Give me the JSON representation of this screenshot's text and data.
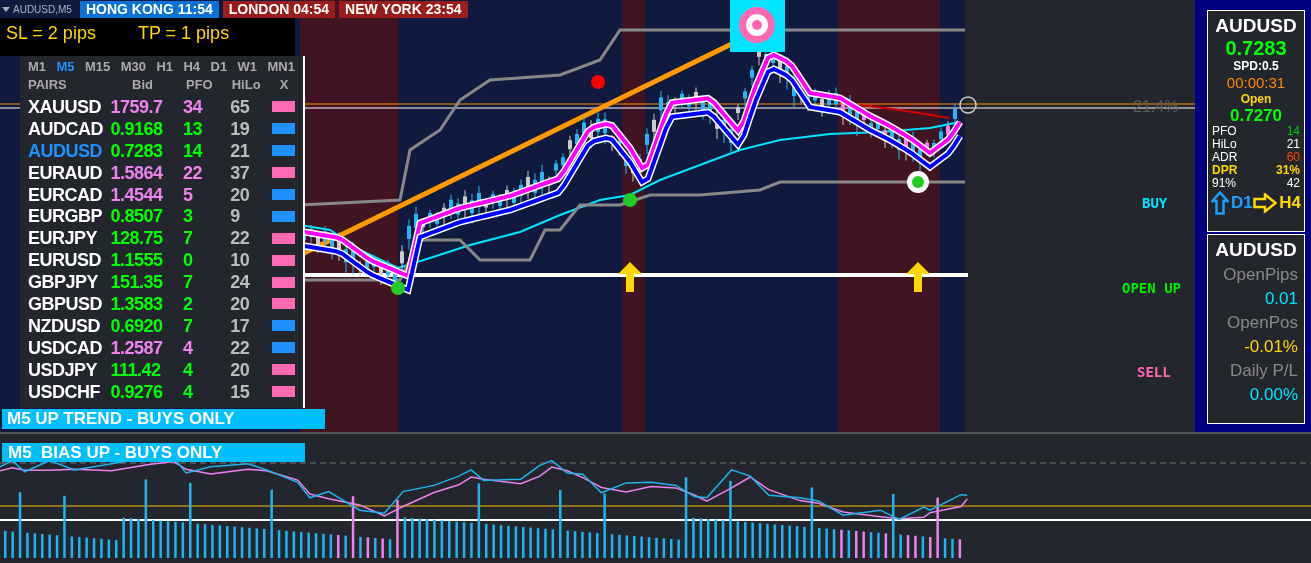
{
  "symbol_label": "AUDUSD,M5",
  "sessions": [
    {
      "city": "HONG KONG",
      "time": "11:54",
      "active": true
    },
    {
      "city": "LONDON",
      "time": "04:54",
      "active": false
    },
    {
      "city": "NEW YORK",
      "time": "23:54",
      "active": false
    }
  ],
  "trade_settings": [
    "SL = 2 pips",
    "TP = 1 pips"
  ],
  "dashboard": {
    "timeframes": [
      {
        "label": "M1",
        "selected": false
      },
      {
        "label": "M5",
        "selected": true
      },
      {
        "label": "M15",
        "selected": false
      },
      {
        "label": "M30",
        "selected": false
      },
      {
        "label": "H1",
        "selected": false
      },
      {
        "label": "H4",
        "selected": false
      },
      {
        "label": "D1",
        "selected": false
      },
      {
        "label": "W1",
        "selected": false
      },
      {
        "label": "MN1",
        "selected": false
      }
    ],
    "columns": [
      "PAIRS",
      "Bid",
      "PFO",
      "HiLo",
      "X"
    ],
    "rows": [
      {
        "pair": "XAUUSD",
        "bid": "1759.7",
        "pfo": "34",
        "hilo": "65",
        "bid_up": false,
        "color": "#ff69b4",
        "selected": false
      },
      {
        "pair": "AUDCAD",
        "bid": "0.9168",
        "pfo": "13",
        "hilo": "19",
        "bid_up": true,
        "color": "#1e90ff",
        "selected": false
      },
      {
        "pair": "AUDUSD",
        "bid": "0.7283",
        "pfo": "14",
        "hilo": "21",
        "bid_up": true,
        "color": "#1e90ff",
        "selected": true
      },
      {
        "pair": "EURAUD",
        "bid": "1.5864",
        "pfo": "22",
        "hilo": "37",
        "bid_up": false,
        "color": "#ff69b4",
        "selected": false
      },
      {
        "pair": "EURCAD",
        "bid": "1.4544",
        "pfo": "5",
        "hilo": "20",
        "bid_up": false,
        "color": "#1e90ff",
        "selected": false
      },
      {
        "pair": "EURGBP",
        "bid": "0.8507",
        "pfo": "3",
        "hilo": "9",
        "bid_up": true,
        "color": "#1e90ff",
        "selected": false
      },
      {
        "pair": "EURJPY",
        "bid": "128.75",
        "pfo": "7",
        "hilo": "22",
        "bid_up": true,
        "color": "#ff69b4",
        "selected": false
      },
      {
        "pair": "EURUSD",
        "bid": "1.1555",
        "pfo": "0",
        "hilo": "10",
        "bid_up": true,
        "color": "#ff69b4",
        "selected": false
      },
      {
        "pair": "GBPJPY",
        "bid": "151.35",
        "pfo": "7",
        "hilo": "24",
        "bid_up": true,
        "color": "#ff69b4",
        "selected": false
      },
      {
        "pair": "GBPUSD",
        "bid": "1.3583",
        "pfo": "2",
        "hilo": "20",
        "bid_up": true,
        "color": "#ff69b4",
        "selected": false
      },
      {
        "pair": "NZDUSD",
        "bid": "0.6920",
        "pfo": "7",
        "hilo": "17",
        "bid_up": true,
        "color": "#1e90ff",
        "selected": false
      },
      {
        "pair": "USDCAD",
        "bid": "1.2587",
        "pfo": "4",
        "hilo": "22",
        "bid_up": false,
        "color": "#1e90ff",
        "selected": false
      },
      {
        "pair": "USDJPY",
        "bid": "111.42",
        "pfo": "4",
        "hilo": "20",
        "bid_up": true,
        "color": "#ff69b4",
        "selected": false
      },
      {
        "pair": "USDCHF",
        "bid": "0.9276",
        "pfo": "4",
        "hilo": "15",
        "bid_up": true,
        "color": "#ff69b4",
        "selected": false
      }
    ],
    "trend_banner": "M5 UP TREND - BUYS ONLY"
  },
  "chart": {
    "level_label": "21.4%",
    "signals": [
      {
        "label": "BUY",
        "kind": "buy"
      },
      {
        "label": "OPEN UP",
        "kind": "open"
      },
      {
        "label": "SELL",
        "kind": "sell"
      }
    ]
  },
  "info_panel": {
    "symbol": "AUDUSD",
    "price": "0.7283",
    "spread": "SPD:0.5",
    "timer": "00:00:31",
    "open_label": "Open",
    "open_price": "0.7270",
    "stats": [
      {
        "label": "PFO",
        "value": "14",
        "kind": "good"
      },
      {
        "label": "HiLo",
        "value": "21",
        "kind": "plain"
      },
      {
        "label": "ADR",
        "value": "60",
        "kind": "warn"
      },
      {
        "label": "DPR",
        "value": "31%",
        "kind": "key"
      },
      {
        "label": "91%",
        "value": "42",
        "kind": "plain"
      }
    ],
    "arrows": [
      {
        "label": "D1",
        "kind": "up"
      },
      {
        "label": "H4",
        "kind": "right"
      }
    ]
  },
  "position_panel": {
    "symbol": "AUDUSD",
    "metrics": [
      {
        "label": "OpenPips",
        "value": "0.01",
        "kind": "positive"
      },
      {
        "label": "OpenPos",
        "value": "-0.01%",
        "kind": "negative"
      },
      {
        "label": "Daily P/L",
        "value": "0.00%",
        "kind": "positive"
      }
    ]
  },
  "indicator": {
    "banner": "M5  BIAS UP - BUYS ONLY"
  }
}
